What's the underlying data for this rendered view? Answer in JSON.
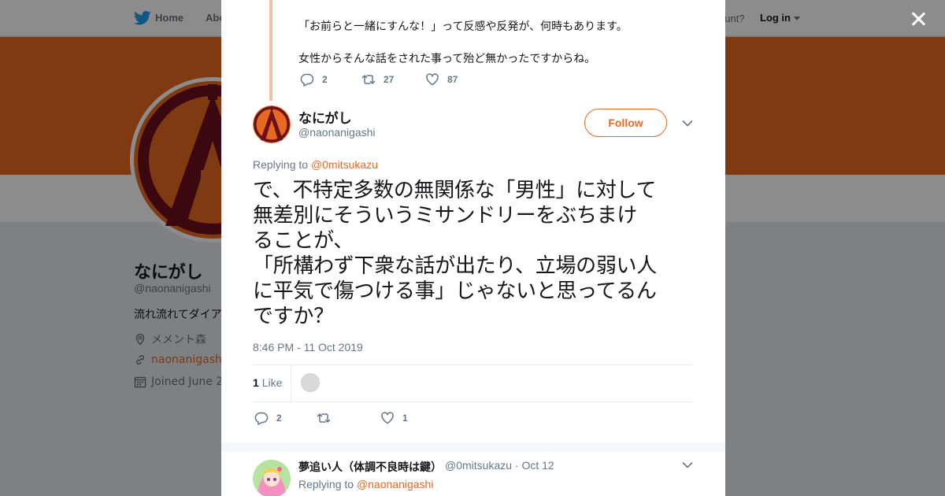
{
  "nav": {
    "home_label": "Home",
    "about_label": "Abo",
    "account_text": "ccount?",
    "login_label": "Log in"
  },
  "profile": {
    "name": "なにがし",
    "handle": "@naonanigashi",
    "bio": "流れ流れてダイア",
    "location": "メメント森",
    "url": "naonanigashi.",
    "joined": "Joined June 2"
  },
  "colors": {
    "brand": "#e76a22",
    "avatar_dark": "#6b0f1a"
  },
  "previous_tweet": {
    "line1": "「お前らと一緒にすんな！」って反感や反発が、何時もあります。",
    "line2": "女性からそんな話をされた事って殆ど無かったですからね。",
    "replies": "2",
    "retweets": "27",
    "likes": "87"
  },
  "main_tweet": {
    "author_name": "なにがし",
    "author_handle": "@naonanigashi",
    "follow_label": "Follow",
    "replying_prefix": "Replying to ",
    "replying_to": "@0mitsukazu",
    "text": "で、不特定多数の無関係な「男性」に対して\n無差別にそういうミサンドリーをぶちまけ\nることが、\n「所構わず下衆な話が出たり、立場の弱い人\nに平気で傷つける事」じゃないと思ってるん\nですか？",
    "timestamp": "8:46 PM - 11 Oct 2019",
    "like_count": "1",
    "like_word": "Like",
    "actions": {
      "replies": "2",
      "retweets": "",
      "likes": "1"
    }
  },
  "reply_tweet": {
    "author_name": "夢追い人（体調不良時は鍵）",
    "author_handle": "@0mitsukazu · Oct 12",
    "replying_prefix": "Replying to ",
    "replying_to": "@naonanigashi"
  },
  "icons": [
    "twitter-bird-icon",
    "location-pin-icon",
    "link-icon",
    "calendar-icon",
    "reply-icon",
    "retweet-icon",
    "heart-icon",
    "chevron-down-icon",
    "close-icon"
  ]
}
